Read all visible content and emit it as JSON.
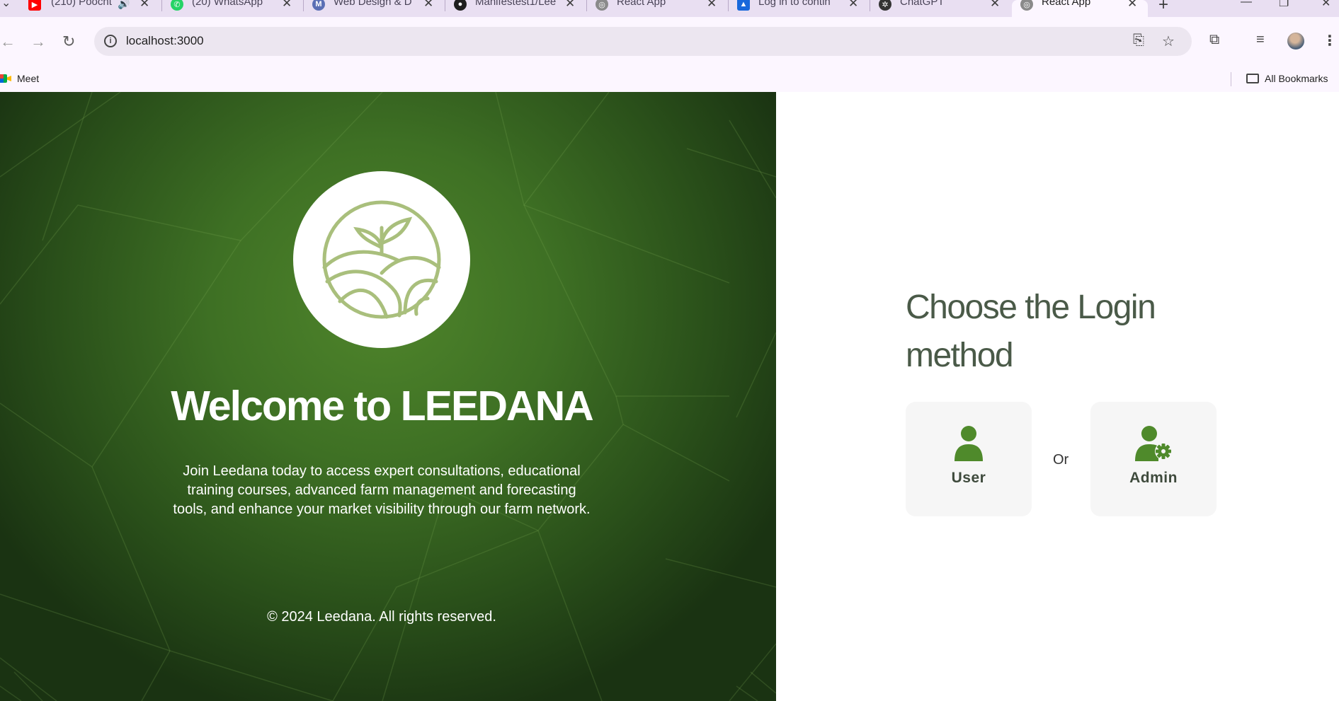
{
  "browser": {
    "tabs": [
      {
        "title": "(210) Poocht",
        "icon": "youtube-icon",
        "color": "#ff0000",
        "audio": true
      },
      {
        "title": "(20) WhatsApp",
        "icon": "whatsapp-icon",
        "color": "#25d366"
      },
      {
        "title": "Web Design & D",
        "icon": "web-design-icon",
        "color": "#5b6fb5"
      },
      {
        "title": "Manifestest1/Lee",
        "icon": "github-icon",
        "color": "#1f1f1f"
      },
      {
        "title": "React App",
        "icon": "react-app-icon",
        "color": "#8a8a8a"
      },
      {
        "title": "Log in to contin",
        "icon": "atlassian-icon",
        "color": "#1868db"
      },
      {
        "title": "ChatGPT",
        "icon": "chatgpt-icon",
        "color": "#333333"
      },
      {
        "title": "React App",
        "icon": "react-app-icon",
        "color": "#8a8a8a",
        "active": true
      }
    ],
    "url": "localhost:3000",
    "bookmarks": [
      {
        "label": "Meet",
        "icon": "google-meet-icon"
      }
    ],
    "all_bookmarks_label": "All Bookmarks"
  },
  "hero": {
    "title": "Welcome to LEEDANA",
    "description": "Join Leedana today to access expert consultations, educational training courses, advanced farm management and forecasting tools, and enhance your market visibility through our farm network.",
    "copyright": "© 2024 Leedana. All rights reserved.",
    "logo_icon": "farm-sprout-logo-icon",
    "colors": {
      "green_dark": "#1a3312",
      "green_mid": "#3e7024",
      "green_light": "#4f852b",
      "logo": "#a9bf7c"
    }
  },
  "login": {
    "title": "Choose the Login method",
    "options": [
      {
        "label": "User",
        "icon": "user-icon"
      },
      {
        "label": "Admin",
        "icon": "user-gear-icon"
      }
    ],
    "separator": "Or",
    "colors": {
      "icon": "#4f8a2b",
      "title": "#4a5a48",
      "card_bg": "#f6f6f6"
    }
  }
}
